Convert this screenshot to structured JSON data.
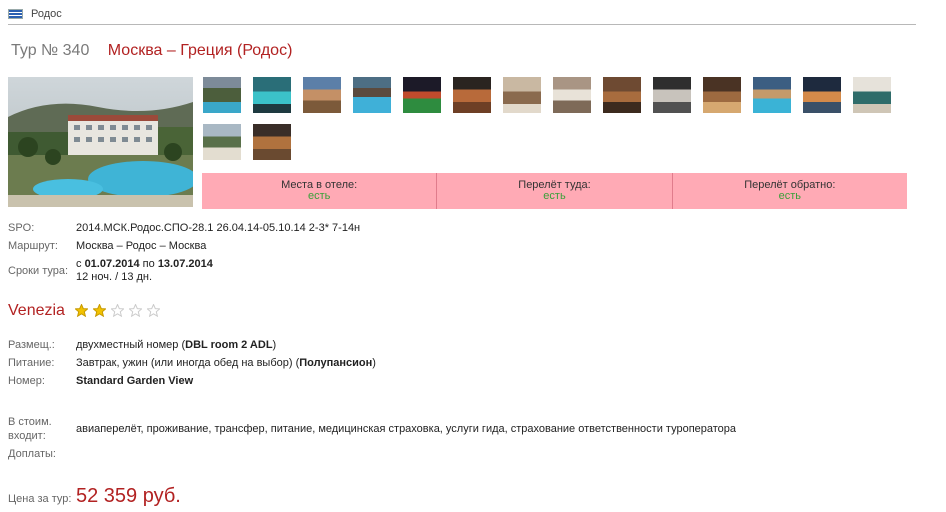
{
  "breadcrumb": {
    "label": "Родос"
  },
  "header": {
    "tour_number": "Тур № 340",
    "route": "Москва – Греция (Родос)"
  },
  "availability": [
    {
      "label": "Места в отеле:",
      "value": "есть"
    },
    {
      "label": "Перелёт туда:",
      "value": "есть"
    },
    {
      "label": "Перелёт обратно:",
      "value": "есть"
    }
  ],
  "tour": {
    "spo_label": "SPO:",
    "spo_value": "2014.МСК.Родос.СПО-28.1 26.04.14-05.10.14 2-3* 7-14н",
    "route_label": "Маршрут:",
    "route_value": "Москва – Родос – Москва",
    "dates_label": "Сроки тура:",
    "dates_from_prefix": "с ",
    "dates_from": "01.07.2014",
    "dates_mid": " по ",
    "dates_to": "13.07.2014",
    "duration": "12 ноч. / 13 дн."
  },
  "hotel": {
    "name": "Venezia",
    "rating": 2,
    "max_rating": 5,
    "room_label": "Размещ.:",
    "room_prefix": "двухместный номер (",
    "room_code": "DBL room 2 ADL",
    "room_suffix": ")",
    "meal_label": "Питание:",
    "meal_prefix": "Завтрак, ужин (или иногда обед на выбор) (",
    "meal_type": "Полупансион",
    "meal_suffix": ")",
    "number_label": "Номер:",
    "number_value": "Standard Garden View"
  },
  "includes": {
    "label_line1": "В стоим.",
    "label_line2": "входит:",
    "value": "авиаперелёт, проживание, трансфер, питание, медицинская страховка, услуги гида, страхование ответственности туроператора",
    "extra_label": "Доплаты:"
  },
  "price": {
    "label": "Цена за тур:",
    "value": "52 359 руб."
  },
  "colors": {
    "accent": "#b22222",
    "availability_bg": "#ffaab5",
    "available_text": "#3aa03a",
    "star_on": "#f2c200",
    "star_off": "#cccccc"
  },
  "icons": {
    "flag": "greek-flag-icon",
    "star": "star-icon"
  }
}
